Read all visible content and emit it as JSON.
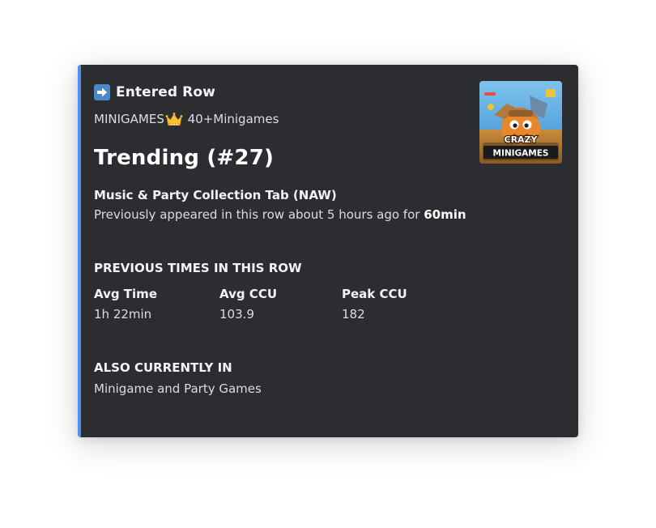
{
  "embed": {
    "author": "Entered Row",
    "author_icon": "right-arrow-icon",
    "subtitle_prefix": "MINIGAMES",
    "subtitle_icon": "crown-icon",
    "subtitle_suffix": " 40+Minigames",
    "title": "Trending (#27)",
    "tab_name": "Music & Party Collection Tab (NAW)",
    "previous_text": "Previously appeared in this row about 5 hours ago for ",
    "previous_duration": "60min",
    "previous_section_header": "PREVIOUS TIMES IN THIS ROW",
    "stats": [
      {
        "label": "Avg Time",
        "value": "1h 22min"
      },
      {
        "label": "Avg CCU",
        "value": "103.9"
      },
      {
        "label": "Peak CCU",
        "value": "182"
      }
    ],
    "also_section_header": "ALSO CURRENTLY IN",
    "also_value": "Minigame and Party Games",
    "thumbnail": {
      "line1": "CRAZY",
      "line2": "MINIGAMES"
    },
    "colors": {
      "accent": "#4f8ff2",
      "background": "#2b2d31"
    }
  }
}
